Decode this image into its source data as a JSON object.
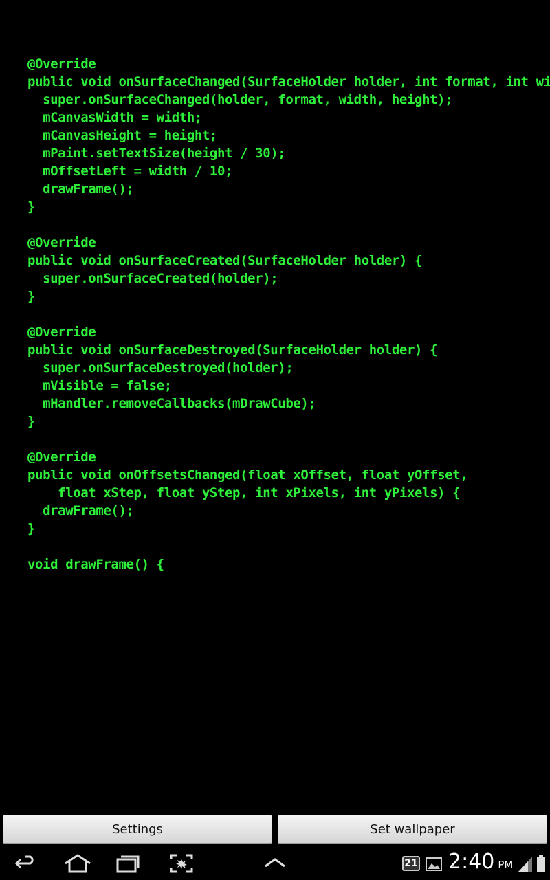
{
  "code_lines": [
    "@Override",
    "public void onSurfaceChanged(SurfaceHolder holder, int format, int width, i",
    "  super.onSurfaceChanged(holder, format, width, height);",
    "  mCanvasWidth = width;",
    "  mCanvasHeight = height;",
    "  mPaint.setTextSize(height / 30);",
    "  mOffsetLeft = width / 10;",
    "  drawFrame();",
    "}",
    "",
    "@Override",
    "public void onSurfaceCreated(SurfaceHolder holder) {",
    "  super.onSurfaceCreated(holder);",
    "}",
    "",
    "@Override",
    "public void onSurfaceDestroyed(SurfaceHolder holder) {",
    "  super.onSurfaceDestroyed(holder);",
    "  mVisible = false;",
    "  mHandler.removeCallbacks(mDrawCube);",
    "}",
    "",
    "@Override",
    "public void onOffsetsChanged(float xOffset, float yOffset,",
    "    float xStep, float yStep, int xPixels, int yPixels) {",
    "  drawFrame();",
    "}",
    "",
    "void drawFrame() {"
  ],
  "buttons": {
    "settings": "Settings",
    "set_wallpaper": "Set wallpaper"
  },
  "status": {
    "notification_count": "21",
    "time": "2:40",
    "ampm": "PM"
  },
  "icons": {
    "back": "back-icon",
    "home": "home-icon",
    "recent": "recent-apps-icon",
    "screenshot": "screenshot-icon",
    "up": "chevron-up-icon",
    "gallery": "gallery-icon",
    "signal": "signal-icon"
  },
  "colors": {
    "code_text": "#2ef03a",
    "background": "#000000"
  }
}
